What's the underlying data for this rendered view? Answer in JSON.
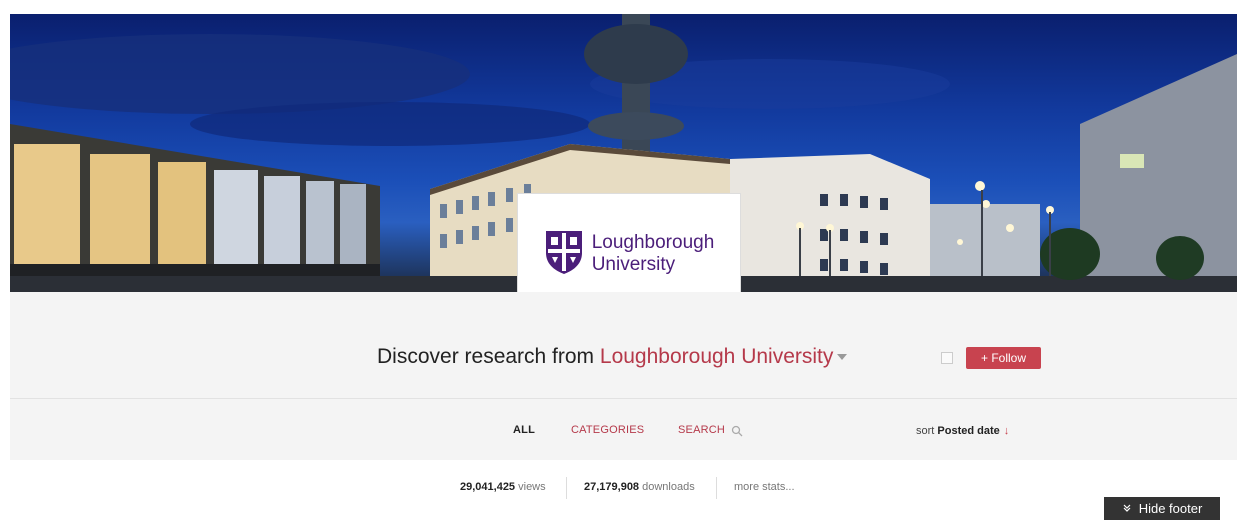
{
  "banner": {
    "logo": {
      "line1": "Loughborough",
      "line2": "University",
      "icon": "university-crest-icon"
    }
  },
  "discover": {
    "prefix": "Discover research from ",
    "institution": "Loughborough University"
  },
  "follow": {
    "label": "+ Follow"
  },
  "tabs": {
    "all": "ALL",
    "categories": "CATEGORIES",
    "search": "SEARCH"
  },
  "sort": {
    "prefix": "sort ",
    "value": "Posted date",
    "arrow": "↓"
  },
  "stats": {
    "views_count": "29,041,425",
    "views_label": " views",
    "downloads_count": "27,179,908",
    "downloads_label": " downloads",
    "more": "more stats..."
  },
  "footer": {
    "hide_label": "Hide footer"
  },
  "colors": {
    "accent": "#c8434f",
    "brand_purple": "#4b1e7a"
  }
}
